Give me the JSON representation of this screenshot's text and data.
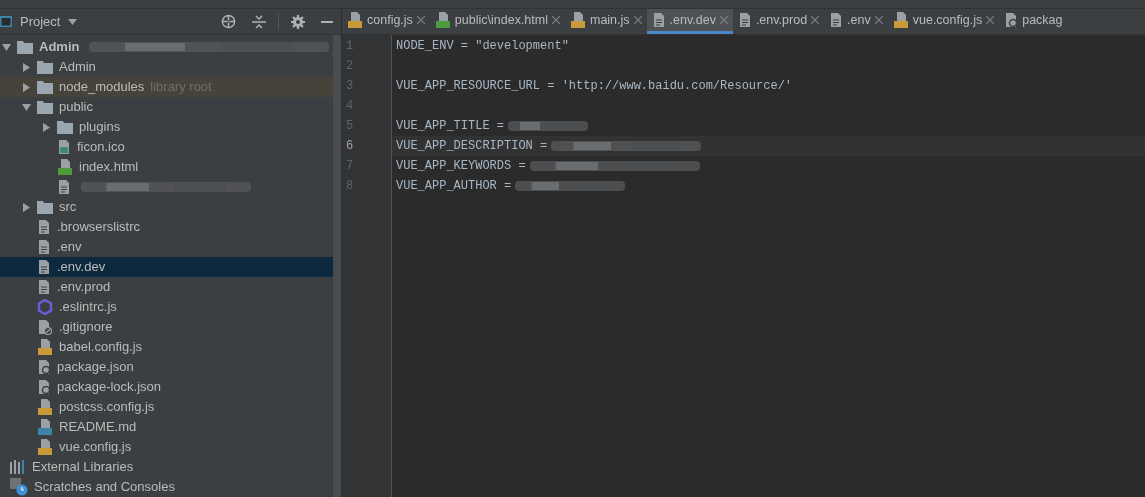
{
  "project_panel": {
    "title": "Project"
  },
  "tree": [
    {
      "label": "Admin",
      "kind": "folder",
      "root": true,
      "expanded": true,
      "selected": false,
      "redacted": true,
      "children": [
        {
          "label": "Admin",
          "kind": "folder",
          "expanded": false,
          "selected": false
        },
        {
          "label": "node_modules",
          "kind": "library-folder",
          "note": "library root",
          "expanded": false,
          "selected": false
        },
        {
          "label": "public",
          "kind": "folder",
          "expanded": true,
          "selected": false,
          "children": [
            {
              "label": "plugins",
              "kind": "folder",
              "expanded": false,
              "selected": false
            },
            {
              "label": "ficon.ico",
              "kind": "image",
              "selected": false
            },
            {
              "label": "index.html",
              "kind": "html",
              "selected": false
            },
            {
              "kind": "redacted",
              "selected": false
            }
          ]
        },
        {
          "label": "src",
          "kind": "folder",
          "expanded": false,
          "selected": false
        },
        {
          "label": ".browserslistrc",
          "kind": "text",
          "selected": false
        },
        {
          "label": ".env",
          "kind": "text",
          "selected": false
        },
        {
          "label": ".env.dev",
          "kind": "text",
          "selected": true
        },
        {
          "label": ".env.prod",
          "kind": "text",
          "selected": false
        },
        {
          "label": ".eslintrc.js",
          "kind": "eslint",
          "selected": false
        },
        {
          "label": ".gitignore",
          "kind": "ignore",
          "selected": false
        },
        {
          "label": "babel.config.js",
          "kind": "js",
          "selected": false
        },
        {
          "label": "package.json",
          "kind": "json",
          "selected": false
        },
        {
          "label": "package-lock.json",
          "kind": "json",
          "selected": false
        },
        {
          "label": "postcss.config.js",
          "kind": "js",
          "selected": false
        },
        {
          "label": "README.md",
          "kind": "md",
          "selected": false
        },
        {
          "label": "vue.config.js",
          "kind": "js",
          "selected": false
        }
      ]
    },
    {
      "label": "External Libraries",
      "kind": "libraries",
      "selected": false
    },
    {
      "label": "Scratches and Consoles",
      "kind": "scratches",
      "selected": false
    }
  ],
  "tabs": [
    {
      "label": "config.js",
      "kind": "js",
      "selected": false,
      "closable": true
    },
    {
      "label": "public\\index.html",
      "kind": "html",
      "selected": false,
      "closable": true
    },
    {
      "label": "main.js",
      "kind": "js",
      "selected": false,
      "closable": true
    },
    {
      "label": ".env.dev",
      "kind": "text",
      "selected": true,
      "closable": true
    },
    {
      "label": ".env.prod",
      "kind": "text",
      "selected": false,
      "closable": true
    },
    {
      "label": ".env",
      "kind": "text",
      "selected": false,
      "closable": true
    },
    {
      "label": "vue.config.js",
      "kind": "js",
      "selected": false,
      "closable": true
    },
    {
      "label": "packag",
      "kind": "json",
      "selected": false,
      "closable": false
    }
  ],
  "code_lines": [
    {
      "number": "1",
      "text": "NODE_ENV = \"development\"",
      "current": false,
      "redacted": false
    },
    {
      "number": "2",
      "current": false,
      "redacted": false
    },
    {
      "number": "3",
      "text": "VUE_APP_RESOURCE_URL = 'http://www.baidu.com/Resource/'",
      "current": false,
      "redacted": false
    },
    {
      "number": "4",
      "current": false,
      "redacted": false
    },
    {
      "number": "5",
      "text": "VUE_APP_TITLE =",
      "current": false,
      "redacted": true
    },
    {
      "number": "6",
      "text": "VUE_APP_DESCRIPTION =",
      "current": true,
      "redacted": true
    },
    {
      "number": "7",
      "text": "VUE_APP_KEYWORDS =",
      "current": false,
      "redacted": true
    },
    {
      "number": "8",
      "text": "VUE_APP_AUTHOR =",
      "current": false,
      "redacted": true
    }
  ]
}
